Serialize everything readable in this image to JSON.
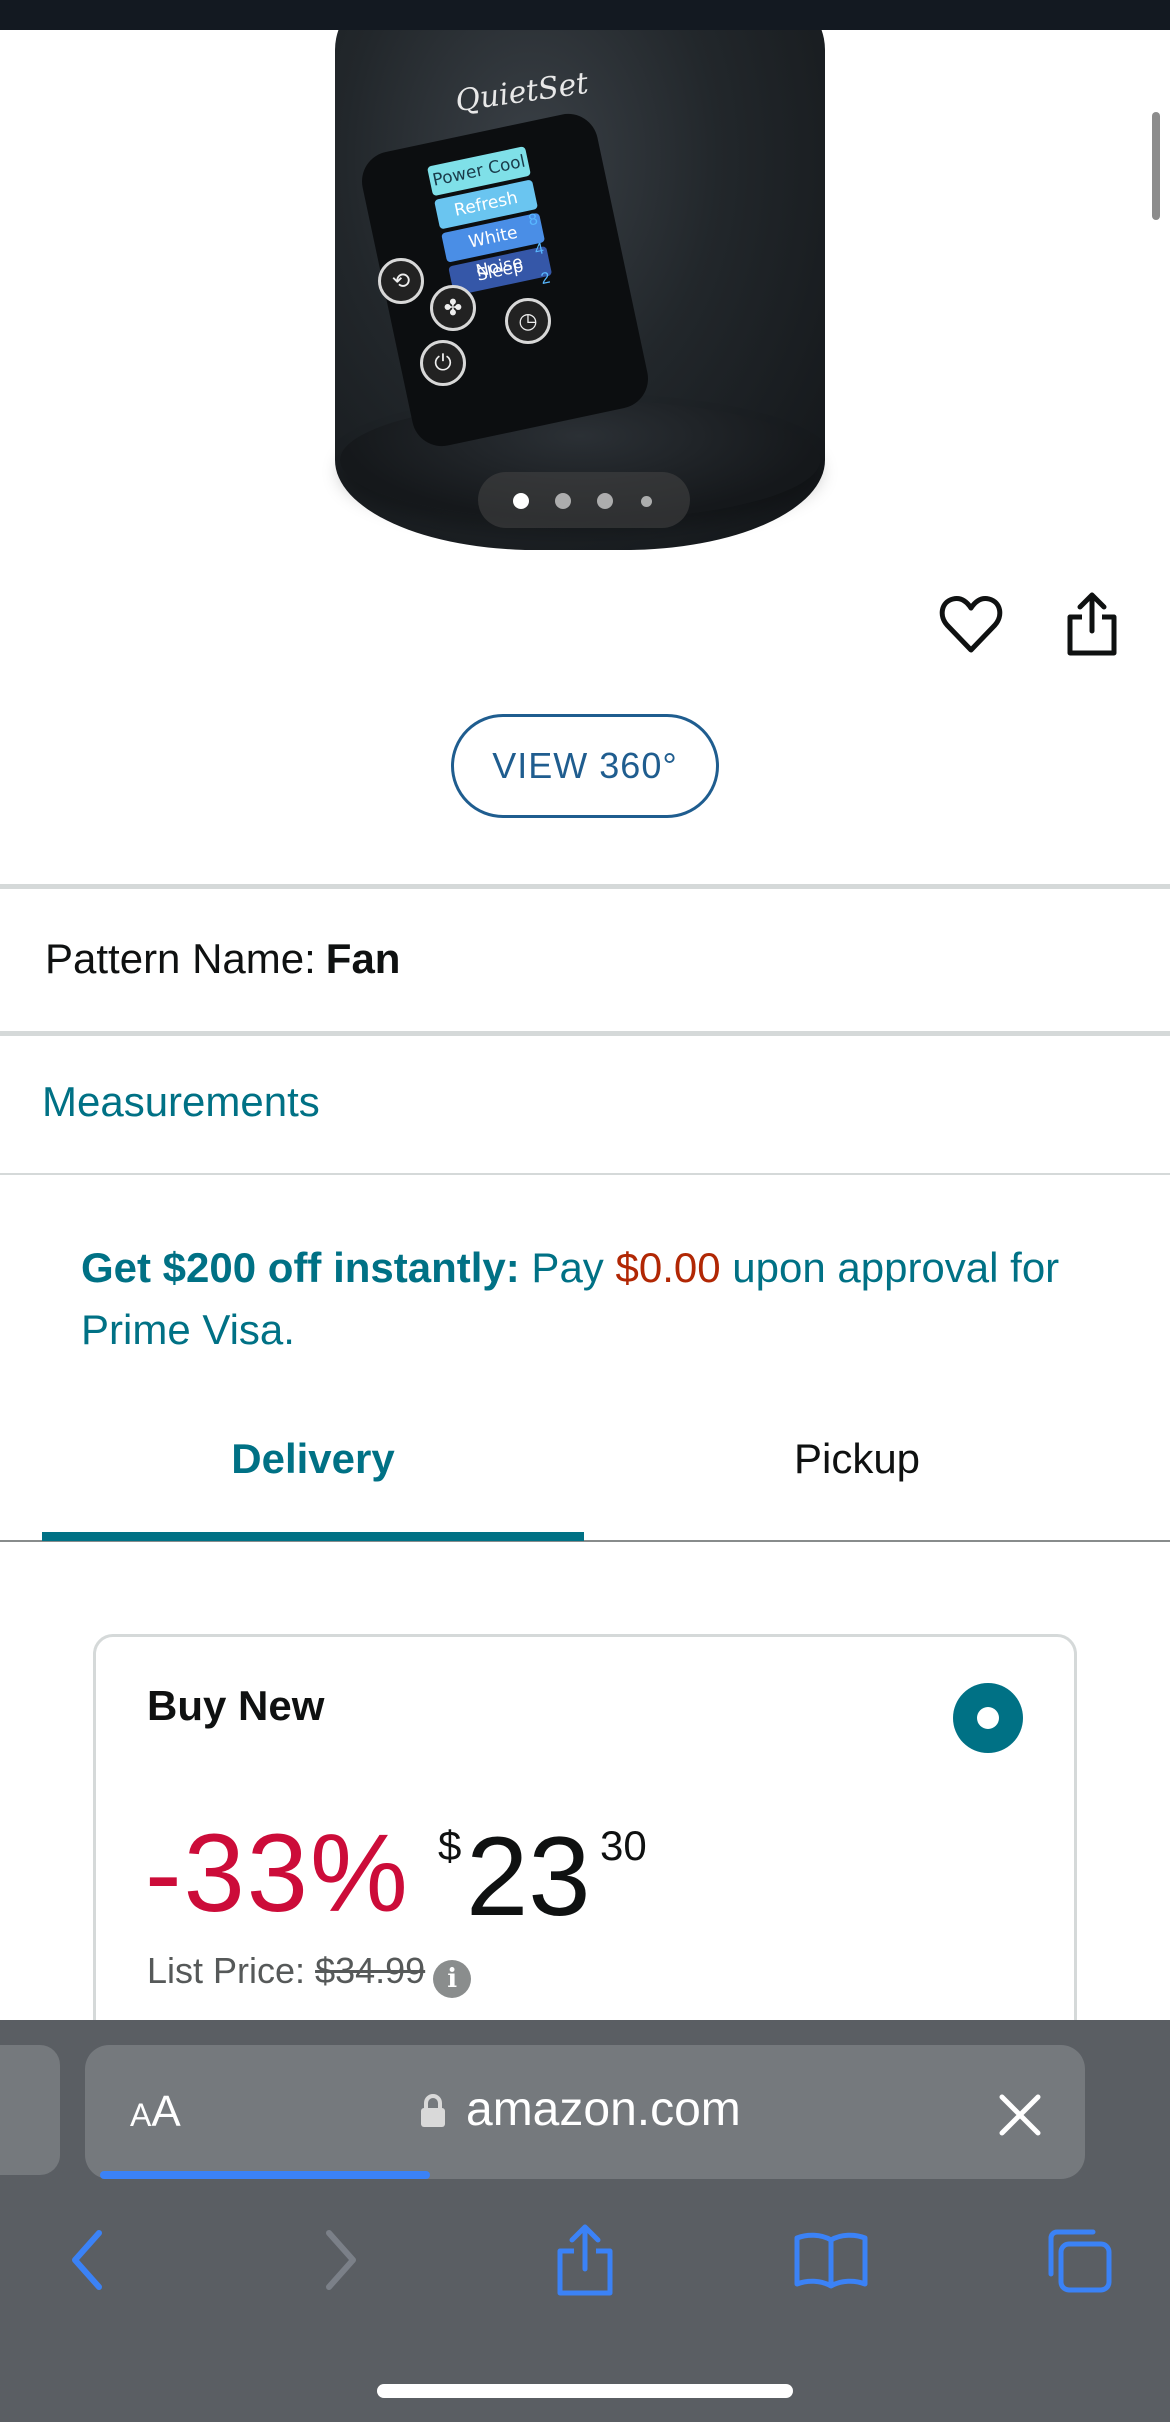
{
  "product_image": {
    "brand": "QuietSet",
    "modes": [
      "Power Cool",
      "Refresh",
      "White Noise",
      "Sleep"
    ],
    "timer_values": [
      "8",
      "4",
      "2"
    ],
    "carousel": {
      "total": 4,
      "active_index": 0
    }
  },
  "actions": {
    "view360_label": "VIEW 360°"
  },
  "pattern": {
    "label": "Pattern Name:",
    "value": "Fan"
  },
  "measurements_link": "Measurements",
  "promo": {
    "strong": "Get $200 off instantly:",
    "text_before_price": " Pay ",
    "price": "$0.00",
    "text_after_price": " upon approval for Prime Visa."
  },
  "tabs": [
    {
      "label": "Delivery",
      "selected": true
    },
    {
      "label": "Pickup",
      "selected": false
    }
  ],
  "buy_box": {
    "title": "Buy New",
    "selected": true,
    "discount": "-33%",
    "price_symbol": "$",
    "price_whole": "23",
    "price_fraction": "30",
    "list_price_label": "List Price:",
    "list_price": "$34.99"
  },
  "browser": {
    "text_size_label_small": "A",
    "text_size_label_large": "A",
    "url": "amazon.com",
    "load_progress": 0.33
  },
  "colors": {
    "link": "#007185",
    "deal_red": "#cc0c39",
    "price_red": "#b12704",
    "ios_blue": "#3b82f6"
  }
}
